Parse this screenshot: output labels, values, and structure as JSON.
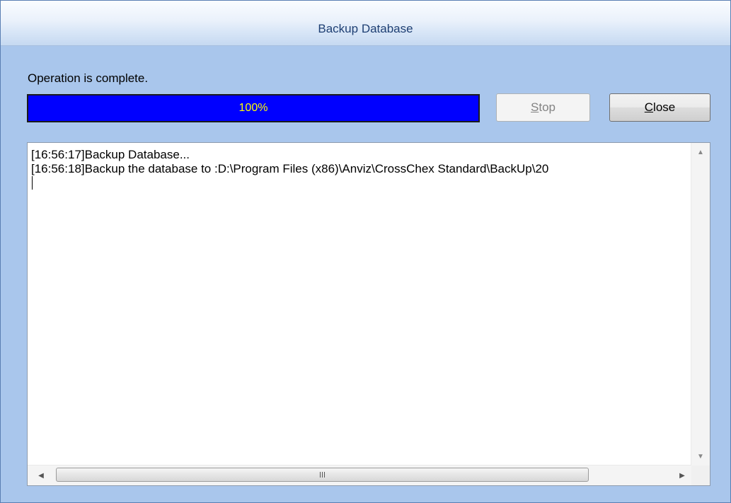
{
  "window": {
    "title": "Backup Database"
  },
  "status": {
    "text": "Operation is complete."
  },
  "progress": {
    "percent": 100,
    "label": "100%"
  },
  "buttons": {
    "stop": {
      "mnemonic": "S",
      "rest": "top",
      "enabled": false
    },
    "close": {
      "mnemonic": "C",
      "rest": "lose",
      "enabled": true
    }
  },
  "log": {
    "lines": [
      "[16:56:17]Backup Database...",
      "[16:56:18]Backup the database to :D:\\Program Files (x86)\\Anviz\\CrossChex Standard\\BackUp\\20"
    ]
  },
  "scrollbar": {
    "grip": "III"
  },
  "colors": {
    "window_bg": "#a9c6ec",
    "progress_fill": "#0000ff",
    "progress_text": "#ffff00",
    "title_text": "#1e3f73"
  }
}
